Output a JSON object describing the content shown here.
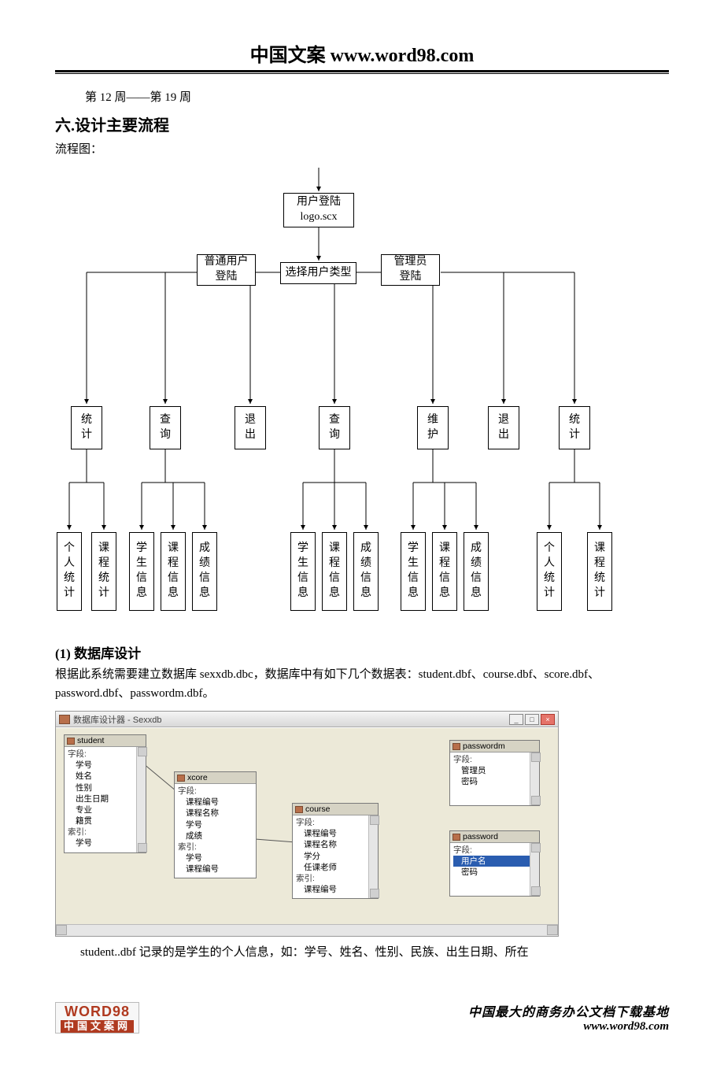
{
  "header": {
    "title": "中国文案 www.word98.com"
  },
  "top_line": "第 12 周——第 19 周",
  "section6_title": "六.设计主要流程",
  "flow_label": "流程图：",
  "flow": {
    "login": "用户登陆\nlogo.scx",
    "normal_user": "普通用户\n登陆",
    "admin_user": "管理员\n登陆",
    "select_type": "选择用户类型",
    "row2": [
      "统\n计",
      "查\n询",
      "退\n出",
      "查\n询",
      "维\n护",
      "退\n出",
      "统\n计"
    ],
    "row3": [
      "个\n人\n统\n计",
      "课\n程\n统\n计",
      "学\n生\n信\n息",
      "课\n程\n信\n息",
      "成\n绩\n信\n息",
      "学\n生\n信\n息",
      "课\n程\n信\n息",
      "成\n绩\n信\n息",
      "学\n生\n信\n息",
      "课\n程\n信\n息",
      "成\n绩\n信\n息",
      "个\n人\n统\n计",
      "课\n程\n统\n计"
    ]
  },
  "db_section": {
    "title": "(1) 数据库设计",
    "para": "根据此系统需要建立数据库 sexxdb.dbc，数据库中有如下几个数据表：student.dbf、course.dbf、score.dbf、password.dbf、passwordm.dbf。",
    "window_title": "数据库设计器 - Sexxdb",
    "labels": {
      "fields": "字段:",
      "index": "索引:"
    },
    "tables": {
      "student": {
        "name": "student",
        "fields": [
          "学号",
          "姓名",
          "性别",
          "出生日期",
          "专业",
          "籍贯"
        ],
        "index": [
          "学号"
        ]
      },
      "xcore": {
        "name": "xcore",
        "fields": [
          "课程编号",
          "课程名称",
          "学号",
          "成绩"
        ],
        "index": [
          "学号",
          "课程编号"
        ]
      },
      "course": {
        "name": "course",
        "fields": [
          "课程编号",
          "课程名称",
          "学分",
          "任课老师"
        ],
        "index": [
          "课程编号"
        ]
      },
      "passwordm": {
        "name": "passwordm",
        "fields": [
          "管理员",
          "密码"
        ]
      },
      "password": {
        "name": "password",
        "fields": [
          "用户名",
          "密码"
        ]
      }
    },
    "after": "student..dbf 记录的是学生的个人信息，如：学号、姓名、性别、民族、出生日期、所在"
  },
  "footer": {
    "brand": "WORD98",
    "brand_sub": "中国文案网",
    "right1": "中国最大的商务办公文档下载基地",
    "right2": "www.word98.com"
  }
}
